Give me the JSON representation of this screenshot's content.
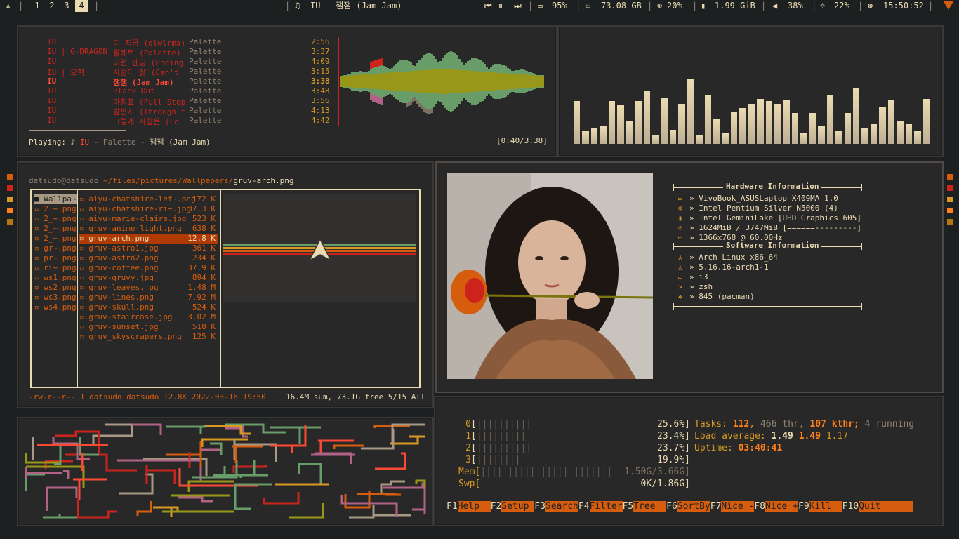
{
  "topbar": {
    "launcher": "⋏",
    "workspaces": [
      "1",
      "2",
      "3",
      "4"
    ],
    "active_workspace": "4",
    "sep": "|",
    "music_icon": "♫",
    "now_playing": "IU - 잼잼 (Jam Jam)",
    "media_prev": "⏮",
    "media_pause": "⏸",
    "media_next": "⏭",
    "battery": "95%",
    "disk": "73.08 GB",
    "cpu": "20%",
    "mem": "1.99 GiB",
    "volume": "38%",
    "brightness": "22%",
    "clock": "15:50:52"
  },
  "music": {
    "tracks": [
      {
        "artist": "IU",
        "title": "이 지금 (dlwlrma)",
        "album": "Palette",
        "time": "2:56",
        "current": false
      },
      {
        "artist": "IU | G-DRAGON",
        "title": "팔레트 (Palette)",
        "album": "Palette",
        "time": "3:37",
        "current": false
      },
      {
        "artist": "IU",
        "title": "이런 엔딩 (Ending",
        "album": "Palette",
        "time": "4:09",
        "current": false
      },
      {
        "artist": "IU | 오혁",
        "title": "사랑이 잘 (Can't",
        "album": "Palette",
        "time": "3:15",
        "current": false
      },
      {
        "artist": "IU",
        "title": "잼잼 (Jam Jam)",
        "album": "Palette",
        "time": "3:38",
        "current": true
      },
      {
        "artist": "IU",
        "title": "Black Out",
        "album": "Palette",
        "time": "3:48",
        "current": false
      },
      {
        "artist": "IU",
        "title": "마침표 (Full Stop",
        "album": "Palette",
        "time": "3:56",
        "current": false
      },
      {
        "artist": "IU",
        "title": "밤편지 (Through t",
        "album": "Palette",
        "time": "4:13",
        "current": false
      },
      {
        "artist": "IU",
        "title": "그렇게 사랑은 (Lo",
        "album": "Palette",
        "time": "4:42",
        "current": false
      }
    ],
    "playing_label": "Playing:",
    "playing_note": "♪",
    "playing_artist": "IU",
    "playing_album": "Palette",
    "playing_title": "잼잼 (Jam Jam)",
    "dash": "-",
    "progress": "[0:40/3:38]"
  },
  "visualizer": {
    "levels": [
      0.42,
      0.12,
      0.15,
      0.17,
      0.42,
      0.38,
      0.22,
      0.42,
      0.52,
      0.09,
      0.45,
      0.14,
      0.39,
      0.63,
      0.09,
      0.47,
      0.25,
      0.1,
      0.31,
      0.35,
      0.39,
      0.44,
      0.42,
      0.39,
      0.43,
      0.3,
      0.1,
      0.3,
      0.17,
      0.48,
      0.12,
      0.3,
      0.55,
      0.16,
      0.19,
      0.36,
      0.43,
      0.22,
      0.2,
      0.12,
      0.44
    ]
  },
  "ranger": {
    "user_host": "datsudo@datsudo",
    "path": "~/files/pictures/Wallpapers/",
    "file": "gruv-arch.png",
    "left_col": [
      "Wallpa~",
      "2_~.png",
      "2_~.png",
      "2_~.png",
      "2_~.png",
      "gr~.png",
      "pr~.png",
      "ri~.png",
      "ws1.png",
      "ws2.png",
      "ws3.png",
      "ws4.png"
    ],
    "files": [
      {
        "name": "aiyu-chatshire-lef~.png",
        "size": "172 K"
      },
      {
        "name": "aiyu-chatshire-ri~.jpg",
        "size": "37.3 K"
      },
      {
        "name": "aiyu-marie-claire.jpg",
        "size": "523 K"
      },
      {
        "name": "gruv-anime-light.png",
        "size": "638 K"
      },
      {
        "name": "gruv-arch.png",
        "size": "12.8 K"
      },
      {
        "name": "gruv-astro1.jpg",
        "size": "361 K"
      },
      {
        "name": "gruv-astro2.png",
        "size": "234 K"
      },
      {
        "name": "gruv-coffee.png",
        "size": "37.9 K"
      },
      {
        "name": "gruv-gruvy.jpg",
        "size": "894 K"
      },
      {
        "name": "gruv-leaves.jpg",
        "size": "1.48 M"
      },
      {
        "name": "gruv-lines.png",
        "size": "7.92 M"
      },
      {
        "name": "gruv-skull.png",
        "size": "524 K"
      },
      {
        "name": "gruv-staircase.jpg",
        "size": "3.02 M"
      },
      {
        "name": "gruv-sunset.jpg",
        "size": "518 K"
      },
      {
        "name": "gruv_skyscrapers.png",
        "size": "125 K"
      }
    ],
    "selected_index": 4,
    "status_left": "-rw-r--r-- 1 datsudo datsudo 12.8K 2022-03-16 19:50",
    "status_right": "16.4M sum, 73.1G free  5/15  All"
  },
  "neofetch": {
    "hw_title": "Hardware Information",
    "sw_title": "Software Information",
    "hw": [
      {
        "icon": "laptop-icon",
        "glyph": "▭",
        "text": "» VivoBook_ASUSLaptop X409MA 1.0"
      },
      {
        "icon": "cpu-icon",
        "glyph": "⊕",
        "text": "» Intel Pentium Silver N5000 (4)"
      },
      {
        "icon": "gpu-icon",
        "glyph": "▮",
        "text": "» Intel GeminiLake [UHD Graphics 605]"
      },
      {
        "icon": "memory-icon",
        "glyph": "⊘",
        "text": "» 1624MiB / 3747MiB [======---------]"
      },
      {
        "icon": "display-icon",
        "glyph": "▭",
        "text": "» 1366x768 @ 60.00Hz"
      }
    ],
    "sw": [
      {
        "icon": "arch-icon",
        "glyph": "⋏",
        "text": "» Arch Linux x86_64"
      },
      {
        "icon": "kernel-icon",
        "glyph": "♙",
        "text": "» 5.16.16-arch1-1"
      },
      {
        "icon": "wm-icon",
        "glyph": "▭",
        "text": "» i3"
      },
      {
        "icon": "shell-icon",
        "glyph": ">_",
        "text": "» zsh"
      },
      {
        "icon": "packages-icon",
        "glyph": "❖",
        "text": "» 845 (pacman)"
      }
    ]
  },
  "htop": {
    "cpus": [
      {
        "id": "0",
        "bar": "||||||||||",
        "pct": "25.6%]"
      },
      {
        "id": "1",
        "bar": "|||||||||",
        "pct": "23.4%]"
      },
      {
        "id": "2",
        "bar": "||||||||||",
        "pct": "23.7%]"
      },
      {
        "id": "3",
        "bar": "||||||||",
        "pct": "19.9%]"
      }
    ],
    "mem_label": "Mem[",
    "mem_bar": "||||||||||||||||||||||||",
    "mem_val": "1.50G/3.66G]",
    "swp_label": "Swp[",
    "swp_val": "0K/1.86G]",
    "tasks_label": "Tasks:",
    "tasks": "112",
    "thr": "466 thr,",
    "kthr": "107 kthr;",
    "running": "4 running",
    "load_label": "Load average:",
    "load1": "1.49",
    "load5": "1.49",
    "load15": "1.17",
    "uptime_label": "Uptime:",
    "uptime": "03:40:41",
    "fkeys": [
      {
        "key": "F1",
        "label": "Help  "
      },
      {
        "key": "F2",
        "label": "Setup "
      },
      {
        "key": "F3",
        "label": "Search"
      },
      {
        "key": "F4",
        "label": "Filter"
      },
      {
        "key": "F5",
        "label": "Tree  "
      },
      {
        "key": "F6",
        "label": "SortBy"
      },
      {
        "key": "F7",
        "label": "Nice -"
      },
      {
        "key": "F8",
        "label": "Nice +"
      },
      {
        "key": "F9",
        "label": "Kill  "
      },
      {
        "key": "F10",
        "label": "Quit      "
      }
    ]
  },
  "colors": {
    "bg": "#1d2021",
    "panel": "#282828",
    "fg": "#ebdbb2",
    "red": "#cc241d",
    "orange": "#d65d0e",
    "yellow": "#98971a",
    "aqua": "#689d6a",
    "gray": "#928374"
  }
}
